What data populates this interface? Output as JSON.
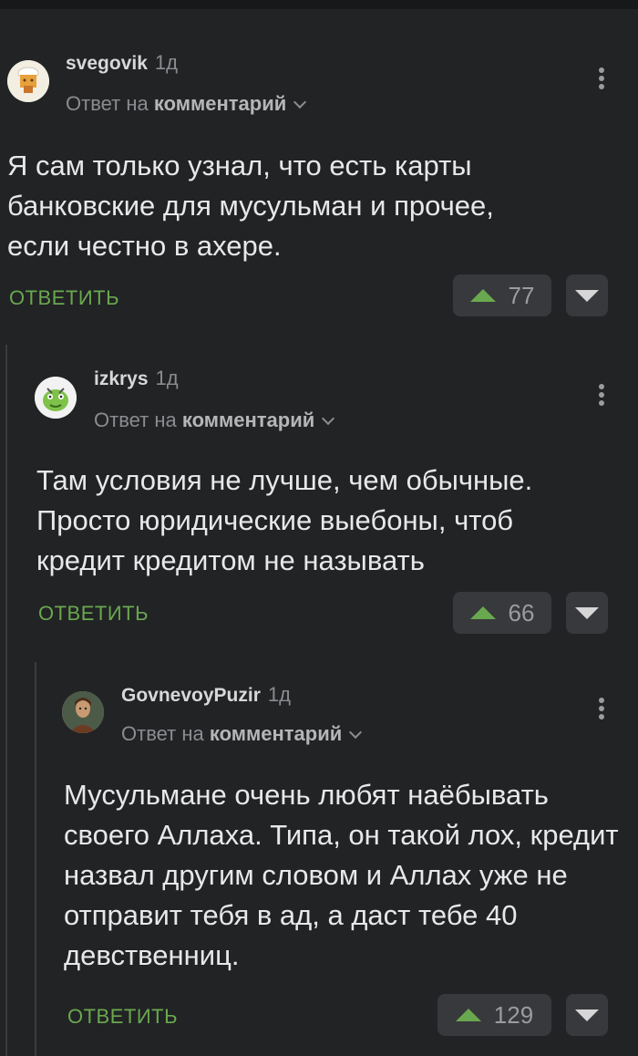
{
  "comments": [
    {
      "username": "svegovik",
      "age": "1д",
      "reply_prefix": "Ответ на",
      "reply_link": "комментарий",
      "text": "Я сам только узнал, что есть карты банковские для мусульман и прочее, если честно в ахере.",
      "reply_label": "ОТВЕТИТЬ",
      "score": "77"
    },
    {
      "username": "izkrys",
      "age": "1д",
      "reply_prefix": "Ответ на",
      "reply_link": "комментарий",
      "text": "Там условия не лучше, чем обычные. Просто юридические выебоны, чтоб кредит кредитом не называть",
      "reply_label": "ОТВЕТИТЬ",
      "score": "66"
    },
    {
      "username": "GovnevoyPuzir",
      "age": "1д",
      "reply_prefix": "Ответ на",
      "reply_link": "комментарий",
      "text": "Мусульмане очень любят наёбывать своего Аллаха. Типа, он такой лох, кредит назвал другим словом и Аллах уже не отправит тебя в ад, а даст тебе 40 девственниц.",
      "reply_label": "ОТВЕТИТЬ",
      "score": "129"
    }
  ],
  "icons": {
    "avatar_1": "cook-avatar",
    "avatar_2": "creature-avatar",
    "avatar_3": "person-avatar",
    "more": "kebab-icon",
    "upvote": "triangle-up-icon",
    "downvote": "triangle-down-icon"
  },
  "colors": {
    "background": "#212325",
    "accent_green": "#6aa84f",
    "muted_text": "#8a8c8f",
    "button_bg": "#38393c"
  }
}
